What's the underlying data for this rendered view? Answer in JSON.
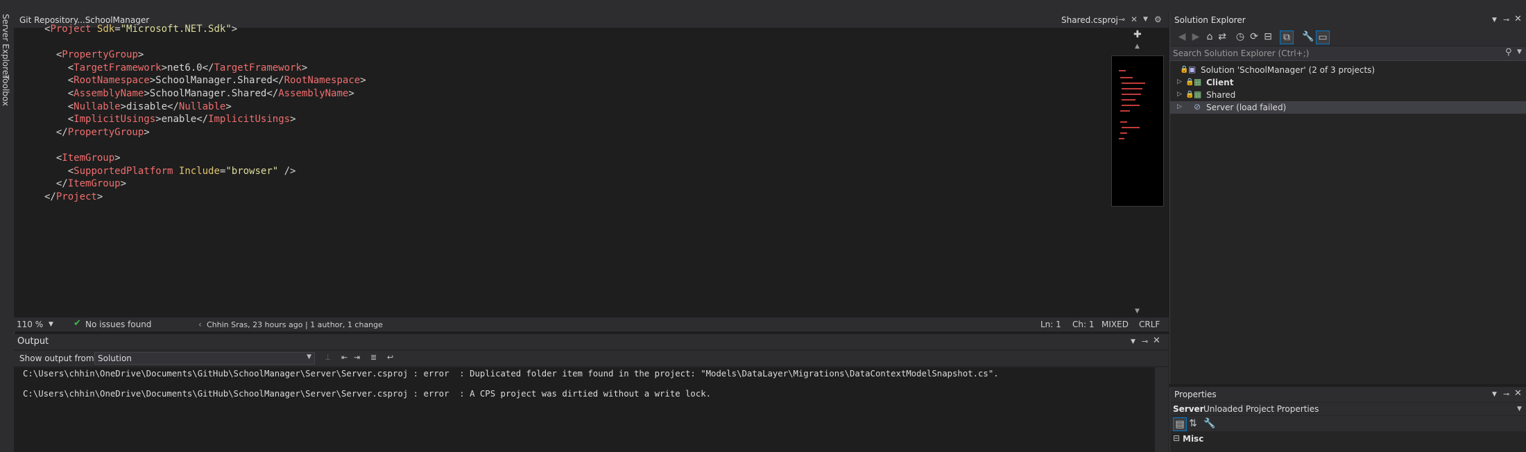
{
  "left_strip": {
    "server_explorer": "Server Explorer",
    "toolbox": "Toolbox"
  },
  "editor": {
    "repo_title": "Git Repository...SchoolManager",
    "tab_file": "Shared.csproj",
    "lines": [
      [
        [
          "brk",
          "<"
        ],
        [
          "tag",
          "Project"
        ],
        [
          "brk",
          " "
        ],
        [
          "attr",
          "Sdk"
        ],
        [
          "brk",
          "="
        ],
        [
          "val",
          "\"Microsoft.NET.Sdk\""
        ],
        [
          "brk",
          ">"
        ]
      ],
      [],
      [
        [
          "brk",
          "  <"
        ],
        [
          "tag",
          "PropertyGroup"
        ],
        [
          "brk",
          ">"
        ]
      ],
      [
        [
          "brk",
          "    <"
        ],
        [
          "tag",
          "TargetFramework"
        ],
        [
          "brk",
          ">"
        ],
        [
          "txt",
          "net6.0"
        ],
        [
          "brk",
          "</"
        ],
        [
          "tag",
          "TargetFramework"
        ],
        [
          "brk",
          ">"
        ]
      ],
      [
        [
          "brk",
          "    <"
        ],
        [
          "tag",
          "RootNamespace"
        ],
        [
          "brk",
          ">"
        ],
        [
          "txt",
          "SchoolManager.Shared"
        ],
        [
          "brk",
          "</"
        ],
        [
          "tag",
          "RootNamespace"
        ],
        [
          "brk",
          ">"
        ]
      ],
      [
        [
          "brk",
          "    <"
        ],
        [
          "tag",
          "AssemblyName"
        ],
        [
          "brk",
          ">"
        ],
        [
          "txt",
          "SchoolManager.Shared"
        ],
        [
          "brk",
          "</"
        ],
        [
          "tag",
          "AssemblyName"
        ],
        [
          "brk",
          ">"
        ]
      ],
      [
        [
          "brk",
          "    <"
        ],
        [
          "tag",
          "Nullable"
        ],
        [
          "brk",
          ">"
        ],
        [
          "txt",
          "disable"
        ],
        [
          "brk",
          "</"
        ],
        [
          "tag",
          "Nullable"
        ],
        [
          "brk",
          ">"
        ]
      ],
      [
        [
          "brk",
          "    <"
        ],
        [
          "tag",
          "ImplicitUsings"
        ],
        [
          "brk",
          ">"
        ],
        [
          "txt",
          "enable"
        ],
        [
          "brk",
          "</"
        ],
        [
          "tag",
          "ImplicitUsings"
        ],
        [
          "brk",
          ">"
        ]
      ],
      [
        [
          "brk",
          "  </"
        ],
        [
          "tag",
          "PropertyGroup"
        ],
        [
          "brk",
          ">"
        ]
      ],
      [],
      [
        [
          "brk",
          "  <"
        ],
        [
          "tag",
          "ItemGroup"
        ],
        [
          "brk",
          ">"
        ]
      ],
      [
        [
          "brk",
          "    <"
        ],
        [
          "tag",
          "SupportedPlatform"
        ],
        [
          "brk",
          " "
        ],
        [
          "attr",
          "Include"
        ],
        [
          "brk",
          "="
        ],
        [
          "val",
          "\"browser\""
        ],
        [
          "brk",
          " />"
        ]
      ],
      [
        [
          "brk",
          "  </"
        ],
        [
          "tag",
          "ItemGroup"
        ],
        [
          "brk",
          ">"
        ]
      ],
      [
        [
          "brk",
          "</"
        ],
        [
          "tag",
          "Project"
        ],
        [
          "brk",
          ">"
        ]
      ]
    ],
    "status": {
      "zoom": "110 %",
      "issues": "No issues found",
      "git_blame": "Chhin Sras, 23 hours ago | 1 author, 1 change",
      "ln": "Ln: 1",
      "ch": "Ch: 1",
      "mixed": "MIXED",
      "crlf": "CRLF"
    }
  },
  "output": {
    "title": "Output",
    "show_from_label": "Show output from:",
    "show_from_value": "Solution",
    "lines": [
      "C:\\Users\\chhin\\OneDrive\\Documents\\GitHub\\SchoolManager\\Server\\Server.csproj : error  : Duplicated folder item found in the project: \"Models\\DataLayer\\Migrations\\DataContextModelSnapshot.cs\".",
      "C:\\Users\\chhin\\OneDrive\\Documents\\GitHub\\SchoolManager\\Server\\Server.csproj : error  : A CPS project was dirtied without a write lock."
    ]
  },
  "solution_explorer": {
    "title": "Solution Explorer",
    "search_placeholder": "Search Solution Explorer (Ctrl+;)",
    "solution_label": "Solution 'SchoolManager' (2 of 3 projects)",
    "projects": [
      {
        "name": "Client",
        "bold": true
      },
      {
        "name": "Shared",
        "bold": false
      },
      {
        "name": "Server (load failed)",
        "bold": false
      }
    ]
  },
  "properties": {
    "title": "Properties",
    "object_name": "Server",
    "object_type": "Unloaded Project Properties",
    "category": "Misc"
  },
  "colors": {
    "tag": "#f06e6e",
    "attr": "#e0c56e",
    "value": "#dcdc9d",
    "accent": "#007acc",
    "ok": "#3fb950"
  }
}
